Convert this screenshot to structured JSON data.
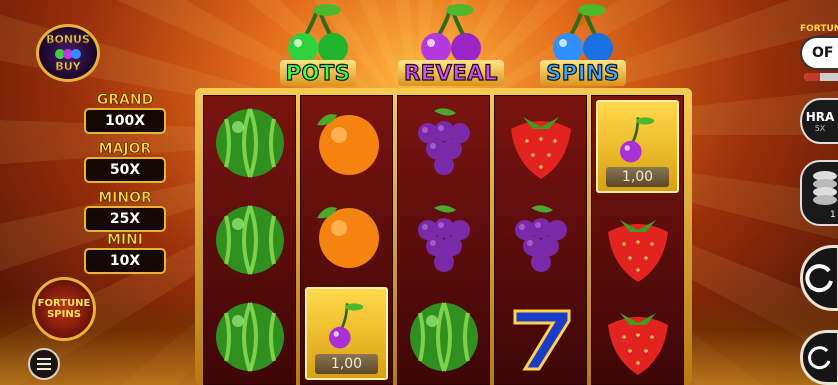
{
  "game": {
    "header": {
      "pots_label": "POTS",
      "reveal_label": "REVEAL",
      "spins_label": "SPINS"
    },
    "bonus_buy": {
      "line1": "BONUS",
      "line2": "BUY"
    },
    "jackpots": [
      {
        "label": "GRAND",
        "value": "100X"
      },
      {
        "label": "MAJOR",
        "value": "50X"
      },
      {
        "label": "MINOR",
        "value": "25X"
      },
      {
        "label": "MINI",
        "value": "10X"
      }
    ],
    "fortune_spins": {
      "line1": "FORTUNE",
      "line2": "SPINS"
    },
    "right_panel": {
      "fortune_label": "FORTUNE",
      "fortune_toggle": "OF",
      "hra_label": "HRA",
      "hra_sub": "5X",
      "coins_value": "1"
    },
    "reels": [
      [
        "watermelon",
        "watermelon",
        "watermelon"
      ],
      [
        "orange",
        "orange",
        "bonus-cherry"
      ],
      [
        "grapes",
        "grapes",
        "watermelon"
      ],
      [
        "strawberry",
        "grapes",
        "seven"
      ],
      [
        "bonus-cherry",
        "strawberry",
        "strawberry"
      ]
    ],
    "bonus_values": {
      "reel1_row3": "1,00",
      "reel5_row1": "1,00"
    },
    "colors": {
      "pots": "#3dff4b",
      "reveal": "#d34cff",
      "spins": "#3aa8ff",
      "frame": "#e8b530"
    }
  }
}
